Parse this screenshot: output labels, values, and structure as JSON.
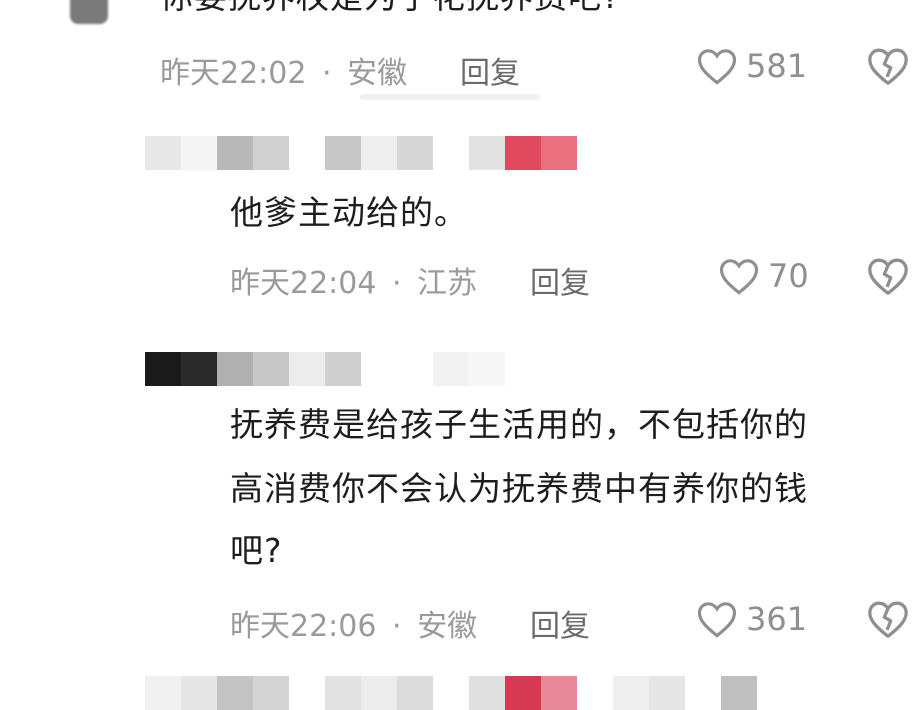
{
  "comments": [
    {
      "text": "你要抚养权是为了花抚养费吧?",
      "time": "昨天22:02",
      "location": "安徽",
      "likes": "581"
    },
    {
      "text": "他爹主动给的。",
      "time": "昨天22:04",
      "location": "江苏",
      "likes": "70"
    },
    {
      "text_lines": [
        "抚养费是给孩子生活用的，不包括你的",
        "高消费你不会认为抚养费中有养你的钱",
        "吧?"
      ],
      "time": "昨天22:06",
      "location": "安徽",
      "likes": "361"
    }
  ],
  "labels": {
    "reply": "回复",
    "separator": "·"
  },
  "icons": [
    "heart-icon",
    "broken-heart-icon"
  ],
  "colors": {
    "text": "#1d1d1f",
    "meta": "#9a9a9a",
    "mosaic_red": "#e04a5f"
  }
}
